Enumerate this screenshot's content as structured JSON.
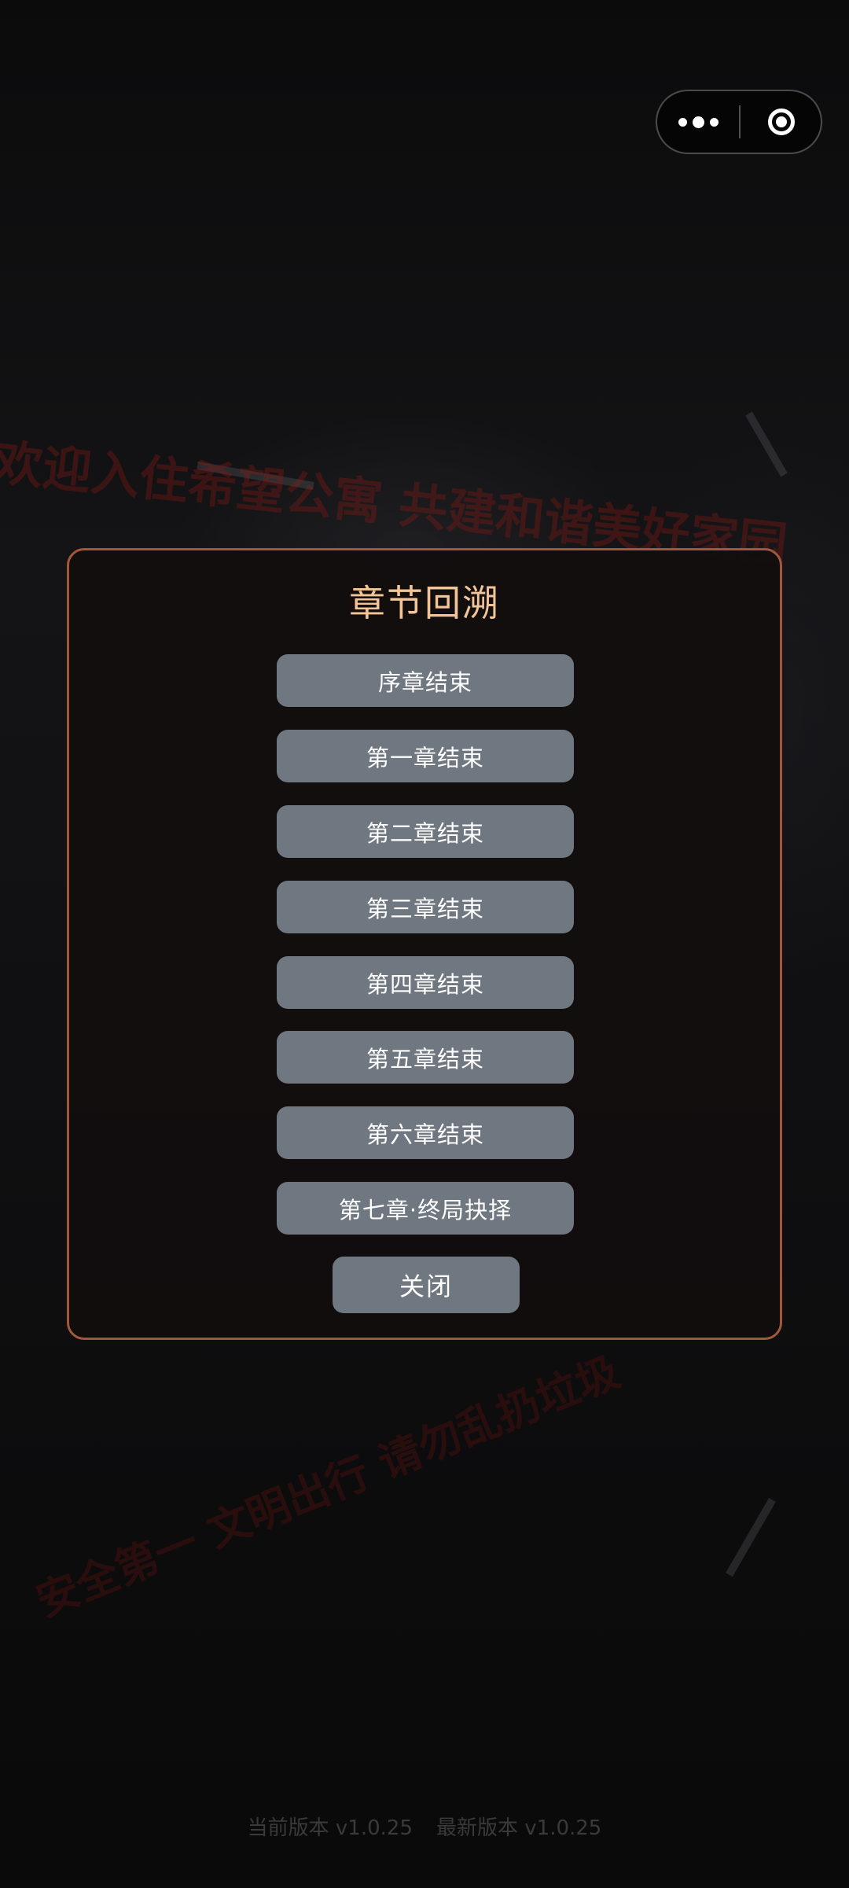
{
  "background": {
    "welcome_sign_text": "欢迎入住希望公寓 共建和谐美好家园",
    "floor_sign_text": "安全第一 文明出行 请勿乱扔垃圾"
  },
  "capsule": {
    "more_icon": "more-dots-icon",
    "close_icon": "target-close-icon"
  },
  "modal": {
    "title": "章节回溯",
    "chapters": [
      "序章结束",
      "第一章结束",
      "第二章结束",
      "第三章结束",
      "第四章结束",
      "第五章结束",
      "第六章结束",
      "第七章·终局抉择"
    ],
    "close_label": "关闭"
  },
  "footer": {
    "current_version": "当前版本 v1.0.25",
    "latest_version": "最新版本 v1.0.25"
  },
  "colors": {
    "modal_border": "#a0583c",
    "title": "#f2c496",
    "button": "#6f7781"
  }
}
